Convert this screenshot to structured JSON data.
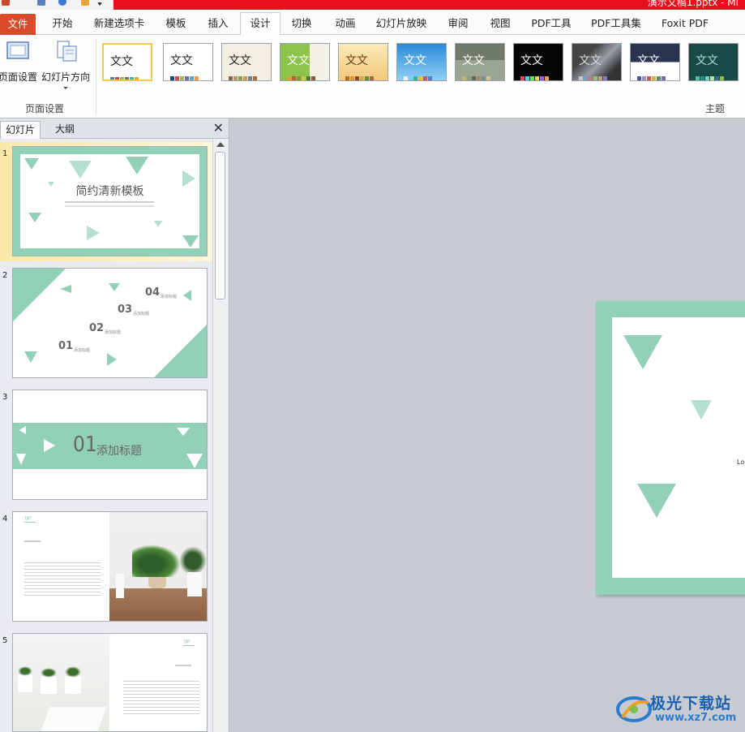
{
  "window": {
    "title": "演示文稿1.pptx - Mi"
  },
  "tabs": [
    {
      "label": "文件"
    },
    {
      "label": "开始"
    },
    {
      "label": "新建选项卡"
    },
    {
      "label": "模板"
    },
    {
      "label": "插入"
    },
    {
      "label": "设计"
    },
    {
      "label": "切换"
    },
    {
      "label": "动画"
    },
    {
      "label": "幻灯片放映"
    },
    {
      "label": "审阅"
    },
    {
      "label": "视图"
    },
    {
      "label": "PDF工具"
    },
    {
      "label": "PDF工具集"
    },
    {
      "label": "Foxit PDF"
    }
  ],
  "ribbon": {
    "page_setup_label": "页面设置",
    "orientation_label": "幻灯片方向",
    "group_page_setup": "页面设置",
    "group_themes": "主题",
    "theme_text": "文文"
  },
  "panel": {
    "tab_slides": "幻灯片",
    "tab_outline": "大纲",
    "close": "✕"
  },
  "slides": [
    {
      "num": "1",
      "title": "简约清新模板"
    },
    {
      "num": "2",
      "items": [
        "04",
        "03",
        "02",
        "01"
      ],
      "item_label": "添加标题"
    },
    {
      "num": "3",
      "title": "01",
      "subtitle": "添加标题"
    },
    {
      "num": "4",
      "tag": "TJKT"
    },
    {
      "num": "5",
      "tag": "TJKT"
    }
  ],
  "main_slide": {
    "partial_text": "Lo"
  },
  "watermark": {
    "name": "极光下载站",
    "url": "www.xz7.com"
  },
  "colors": {
    "accent": "#93d0b8",
    "file_tab": "#d84a2a",
    "title_bar": "#e8101a"
  }
}
